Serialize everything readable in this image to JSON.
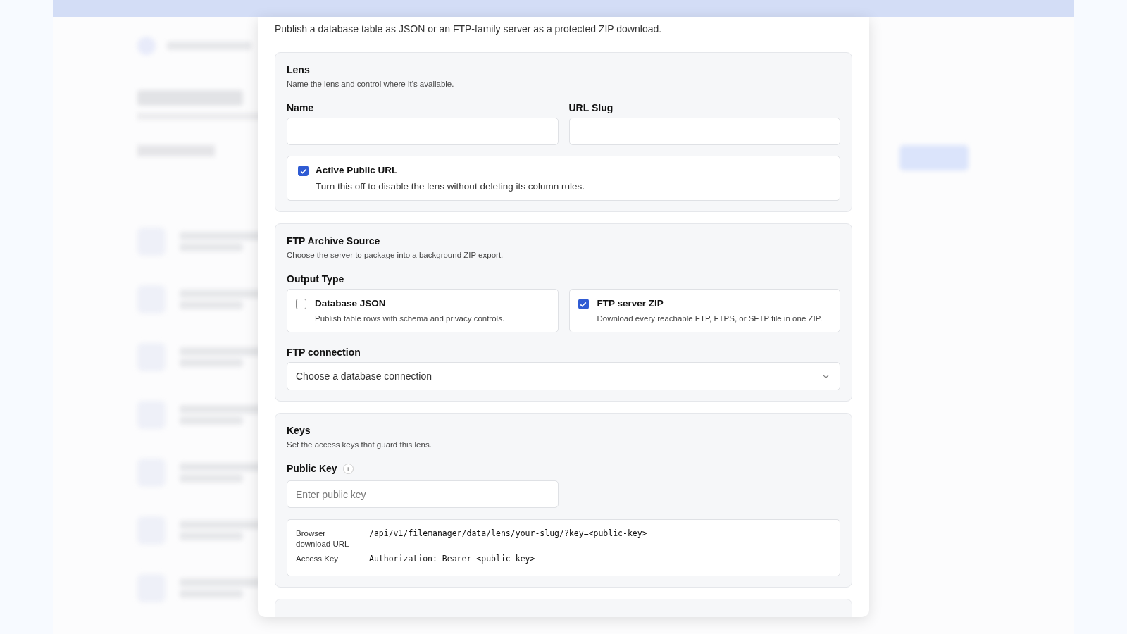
{
  "modal": {
    "intro": "Publish a database table as JSON or an FTP-family server as a protected ZIP download.",
    "lens": {
      "title": "Lens",
      "hint": "Name the lens and control where it's available.",
      "fields": [
        {
          "label": "Name"
        },
        {
          "label": "URL Slug"
        }
      ],
      "toggle": {
        "label": "Active Public URL",
        "description": "Turn this off to disable the lens without deleting its column rules.",
        "checked": true
      }
    },
    "ftp_source": {
      "title": "FTP Archive Source",
      "hint": "Choose the server to package into a background ZIP export.",
      "output_type": {
        "label": "Output Type",
        "options": [
          {
            "label": "Database JSON",
            "description": "Publish table rows with schema and privacy controls.",
            "checked": false
          },
          {
            "label": "FTP server ZIP",
            "description": "Download every reachable FTP, FTPS, or SFTP file in one ZIP.",
            "checked": true
          }
        ]
      },
      "connection": {
        "label": "FTP connection",
        "placeholder": "Choose a database connection"
      }
    },
    "keys": {
      "title": "Keys",
      "hint": "Set the access keys that guard this lens.",
      "public_key": {
        "label": "Public Key",
        "info": "i",
        "placeholder": "Enter public key"
      },
      "endpoints": [
        {
          "label": "Browser download URL",
          "value": "/api/v1/filemanager/data/lens/your-slug/?key=<public-key>"
        },
        {
          "label": "Access Key",
          "value": "Authorization: Bearer <public-key>"
        }
      ]
    }
  }
}
